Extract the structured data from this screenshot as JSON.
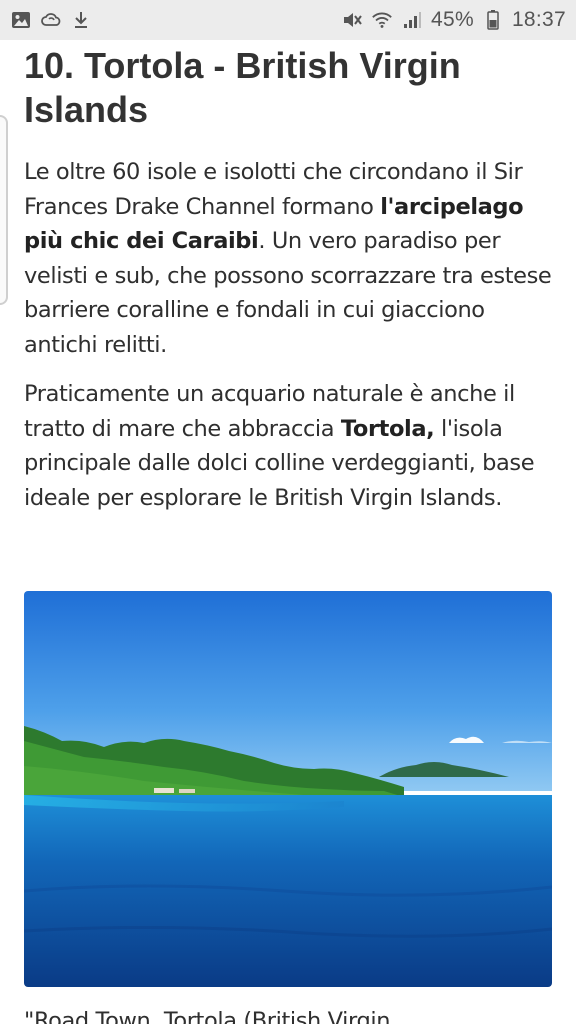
{
  "status_bar": {
    "left_icons": [
      "image-icon",
      "cloud-sync-icon",
      "download-icon"
    ],
    "right_icons": [
      "mute-icon",
      "wifi-icon",
      "signal-icon",
      "battery-icon"
    ],
    "battery": "45%",
    "time": "18:37"
  },
  "article": {
    "title": "10. Tortola - British Virgin Islands",
    "para1": {
      "lead": "Le oltre 60 isole e isolotti che circondano il Sir Frances Drake Channel formano ",
      "bold": "l'arcipelago più chic dei Caraibi",
      "rest": ". Un vero paradiso per velisti e sub, che possono scorrazzare tra estese barriere coralline e fondali in cui giacciono antichi relitti."
    },
    "para2": {
      "lead": "Praticamente un acquario naturale è anche il tratto di mare che abbraccia ",
      "bold": "Tortola,",
      "rest": " l'isola principale dalle dolci colline verdeggianti, base ideale per esplorare le British Virgin Islands."
    },
    "caption": "\"Road Town, Tortola (British Virgin"
  }
}
